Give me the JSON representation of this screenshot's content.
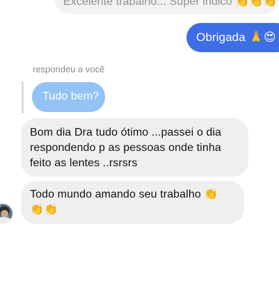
{
  "previous_message": {
    "text": "Excelente trabalho... Super indico 👏👏👏"
  },
  "sent_message": {
    "text": "Obrigada 🙏😍"
  },
  "reply": {
    "label": "respondeu a você",
    "quoted_text": "Tudo bem?"
  },
  "received_messages": [
    {
      "text": "Bom dia Dra tudo ótimo ...passei o dia respondendo p as pessoas onde tinha feito as lentes ..rsrsrs"
    },
    {
      "text": "Todo mundo amando seu trabalho 👏\n👏👏"
    }
  ],
  "colors": {
    "sent_bubble": "#3e6ee6",
    "received_bubble": "#efefef",
    "quoted_bubble": "#93c3f5"
  }
}
